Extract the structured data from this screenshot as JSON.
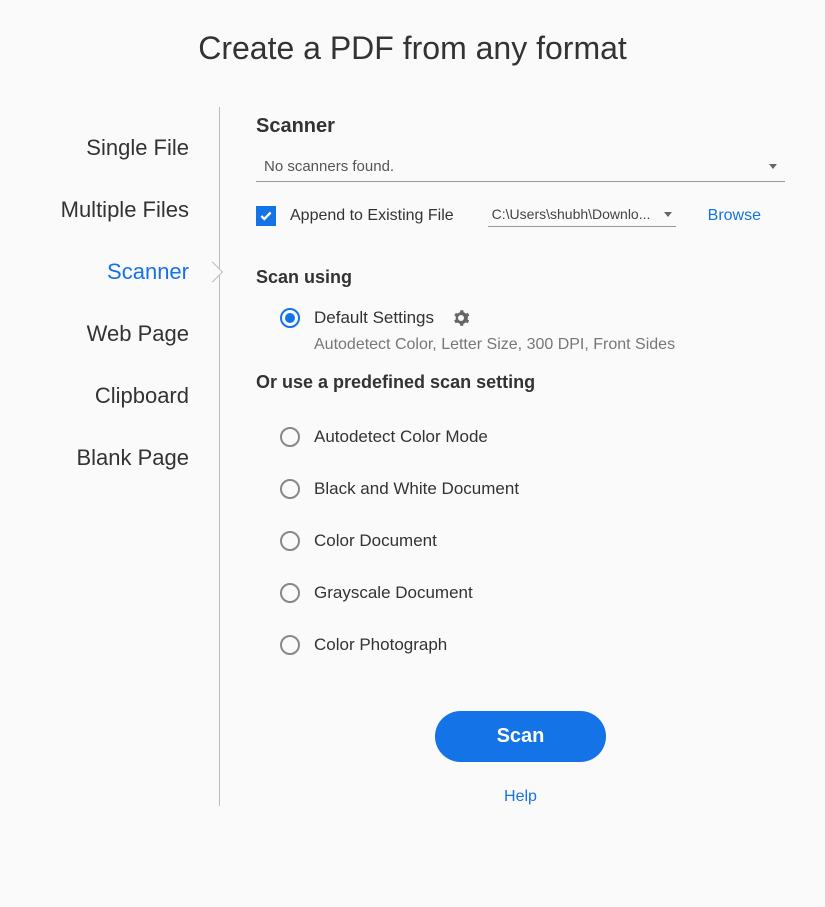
{
  "title": "Create a PDF from any format",
  "sidebar": {
    "items": [
      {
        "label": "Single File"
      },
      {
        "label": "Multiple Files"
      },
      {
        "label": "Scanner"
      },
      {
        "label": "Web Page"
      },
      {
        "label": "Clipboard"
      },
      {
        "label": "Blank Page"
      }
    ],
    "selected_index": 2
  },
  "scanner_section": {
    "heading": "Scanner",
    "dropdown_value": "No scanners found.",
    "append_checked": true,
    "append_label": "Append to Existing File",
    "path_value": "C:\\Users\\shubh\\Downlo...",
    "browse_label": "Browse"
  },
  "scan_using": {
    "heading": "Scan using",
    "default_label": "Default Settings",
    "default_selected": true,
    "default_desc": "Autodetect Color, Letter Size, 300 DPI, Front Sides"
  },
  "presets": {
    "heading": "Or use a predefined scan setting",
    "options": [
      {
        "label": "Autodetect Color Mode"
      },
      {
        "label": "Black and White Document"
      },
      {
        "label": "Color Document"
      },
      {
        "label": "Grayscale Document"
      },
      {
        "label": "Color Photograph"
      }
    ]
  },
  "actions": {
    "scan_label": "Scan",
    "help_label": "Help"
  }
}
